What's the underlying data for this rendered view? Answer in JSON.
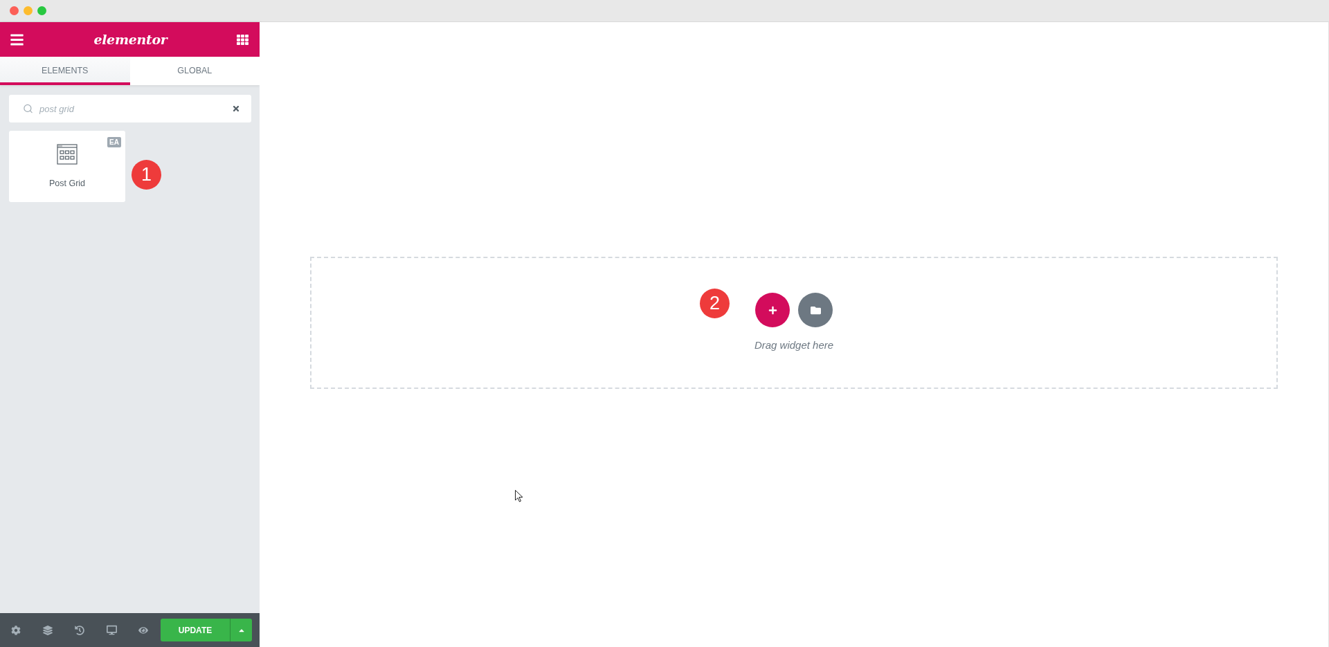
{
  "panel": {
    "logo": "elementor",
    "tabs": [
      {
        "label": "ELEMENTS",
        "selected": true
      },
      {
        "label": "GLOBAL",
        "selected": false
      }
    ],
    "search": {
      "value": "post grid"
    },
    "widgets": [
      {
        "label": "Post Grid",
        "badge": "EA"
      }
    ],
    "step_marker": "1",
    "footer": {
      "update_label": "UPDATE"
    }
  },
  "canvas": {
    "step_marker": "2",
    "drop_hint": "Drag widget here"
  }
}
